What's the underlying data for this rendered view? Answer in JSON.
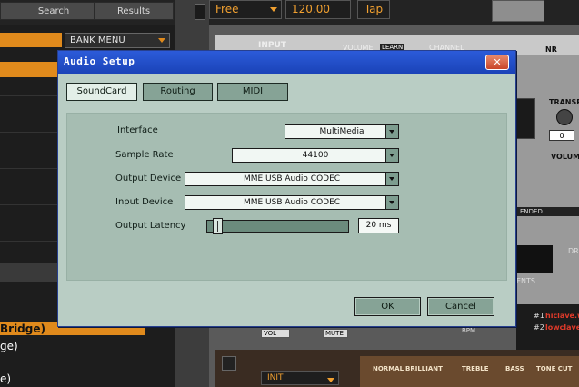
{
  "background": {
    "tabs": [
      "Search",
      "Results"
    ],
    "bank_menu": "BANK MENU",
    "list_items": [
      "Bridge)",
      "ge)",
      "e)"
    ],
    "sync_mode": "Free",
    "tempo": "120.00",
    "tap": "Tap",
    "module_labels": {
      "input": "INPUT",
      "volume": "VOLUME",
      "learn": "LEARN",
      "channel": "CHANNEL",
      "nr": "NR",
      "transpose": "TRANSPO",
      "zero": "0",
      "volume2": "VOLUM",
      "ended": "ENDED",
      "dr": "DR",
      "ents": "ENTS",
      "vol": "VOL",
      "mute": "MUTE",
      "bpm": "BPM",
      "tag1": "#1",
      "tag2": "#2",
      "hiclave": "hiclave.w",
      "lowclave": "lowclave.",
      "init": "INIT",
      "normal": "NORMAL",
      "brilliant": "BRILLIANT",
      "treble": "TREBLE",
      "bass": "BASS",
      "tone_cut": "TONE CUT"
    }
  },
  "dialog": {
    "title": "Audio Setup",
    "close": "✕",
    "tabs": [
      "SoundCard",
      "Routing",
      "MIDI"
    ],
    "interface_label": "Interface",
    "interface_value": "MultiMedia",
    "sample_rate_label": "Sample Rate",
    "sample_rate_value": "44100",
    "output_device_label": "Output Device",
    "output_device_value": "MME USB Audio CODEC",
    "input_device_label": "Input Device",
    "input_device_value": "MME USB Audio CODEC",
    "latency_label": "Output Latency",
    "latency_value": "20 ms",
    "latency_level": 0.05,
    "ok": "OK",
    "cancel": "Cancel"
  },
  "colors": {
    "dialog_bg": "#b9cdc4",
    "titlebar": "#2c5bd9",
    "accent_orange": "#e08a1c"
  }
}
